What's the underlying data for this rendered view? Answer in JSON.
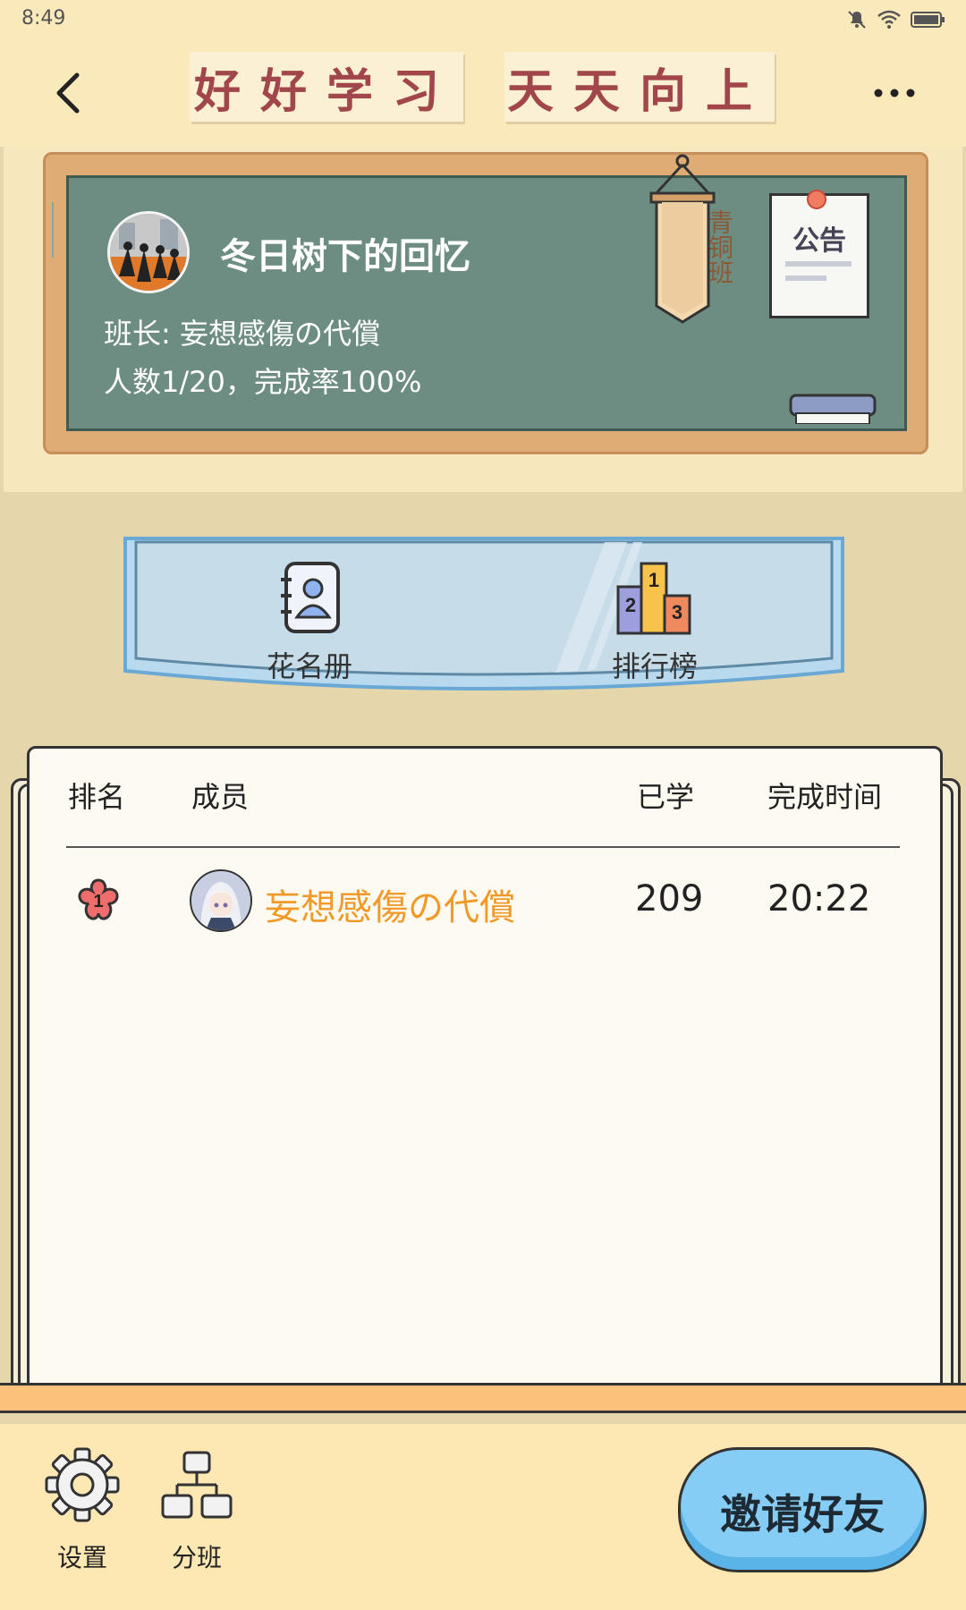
{
  "status_bar": {
    "time": "8:49",
    "icons": [
      "bell-muted-icon",
      "wifi-icon",
      "battery-icon"
    ]
  },
  "header": {
    "banner_left": "好好学习",
    "banner_right": "天天向上",
    "back_icon": "chevron-left-icon",
    "more_icon": "more-dots-icon"
  },
  "class_info": {
    "name": "冬日树下的回忆",
    "monitor_label": "班长:",
    "monitor_name": "妄想感傷の代償",
    "stats": "人数1/20，完成率100%",
    "tier_banner": "青铜班",
    "notice_title": "公告"
  },
  "tabs": [
    {
      "label": "花名册",
      "icon": "roster-book-icon"
    },
    {
      "label": "排行榜",
      "icon": "podium-icon"
    }
  ],
  "table": {
    "headers": {
      "rank": "排名",
      "member": "成员",
      "learned": "已学",
      "time": "完成时间"
    },
    "rows": [
      {
        "rank": "1",
        "name": "妄想感傷の代償",
        "learned": "209",
        "time": "20:22"
      }
    ]
  },
  "bottom_bar": {
    "settings_label": "设置",
    "classes_label": "分班",
    "invite_label": "邀请好友"
  },
  "colors": {
    "background": "#e6d6ab",
    "blackboard": "#6e8d82",
    "banner_text": "#a1464b",
    "member_name": "#f09a2a",
    "invite_button": "#86cdf5"
  }
}
